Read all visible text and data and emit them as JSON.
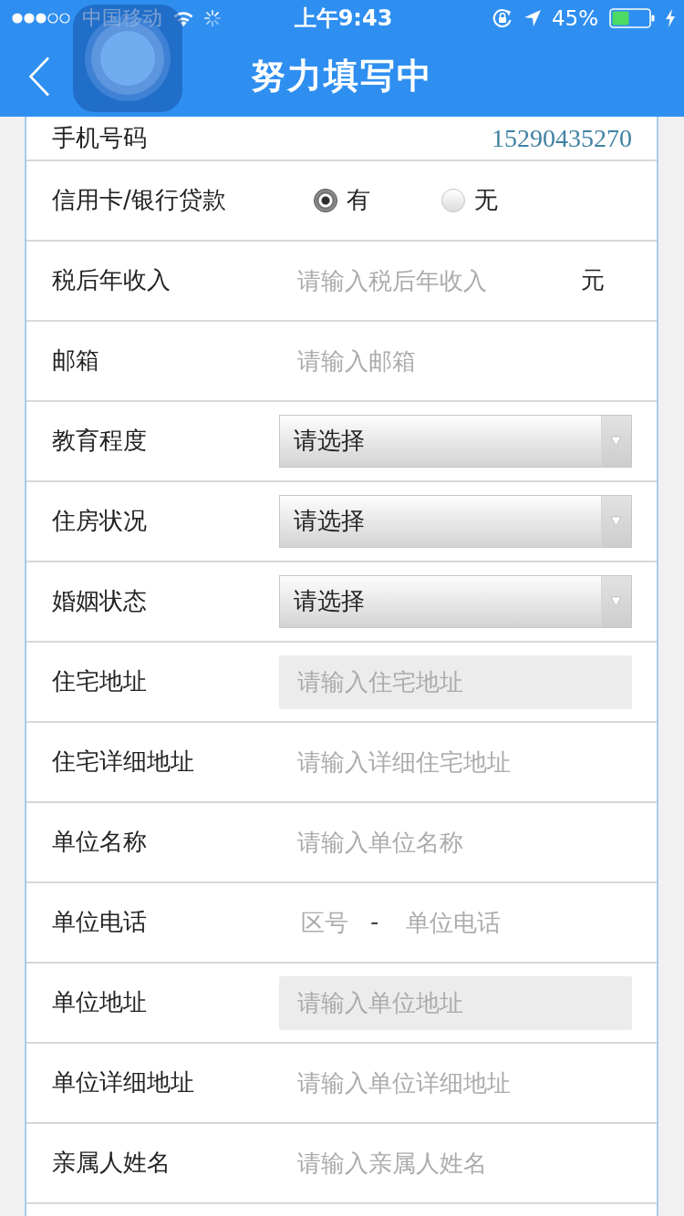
{
  "status_bar": {
    "carrier": "中国移动",
    "time": "上午9:43",
    "battery_percent": "45%"
  },
  "nav_bar": {
    "title": "努力填写中"
  },
  "form": {
    "rows": [
      {
        "kind": "text",
        "label": "手机号码",
        "value": "15290435270"
      },
      {
        "kind": "radio",
        "label": "信用卡/银行贷款",
        "options": [
          {
            "label": "有",
            "selected": true
          },
          {
            "label": "无",
            "selected": false
          }
        ]
      },
      {
        "kind": "input",
        "label": "税后年收入",
        "placeholder": "请输入税后年收入",
        "unit": "元",
        "disabled": false
      },
      {
        "kind": "input",
        "label": "邮箱",
        "placeholder": "请输入邮箱",
        "disabled": false
      },
      {
        "kind": "select",
        "label": "教育程度",
        "value": "请选择"
      },
      {
        "kind": "select",
        "label": "住房状况",
        "value": "请选择"
      },
      {
        "kind": "select",
        "label": "婚姻状态",
        "value": "请选择"
      },
      {
        "kind": "input",
        "label": "住宅地址",
        "placeholder": "请输入住宅地址",
        "disabled": true
      },
      {
        "kind": "input",
        "label": "住宅详细地址",
        "placeholder": "请输入详细住宅地址",
        "disabled": false
      },
      {
        "kind": "input",
        "label": "单位名称",
        "placeholder": "请输入单位名称",
        "disabled": false
      },
      {
        "kind": "phone",
        "label": "单位电话",
        "fields": [
          {
            "placeholder": "区号"
          },
          {
            "placeholder": "单位电话"
          }
        ],
        "separator": "-"
      },
      {
        "kind": "input",
        "label": "单位地址",
        "placeholder": "请输入单位地址",
        "disabled": true
      },
      {
        "kind": "input",
        "label": "单位详细地址",
        "placeholder": "请输入单位详细地址",
        "disabled": false
      },
      {
        "kind": "input",
        "label": "亲属人姓名",
        "placeholder": "请输入亲属人姓名",
        "disabled": false
      }
    ]
  }
}
